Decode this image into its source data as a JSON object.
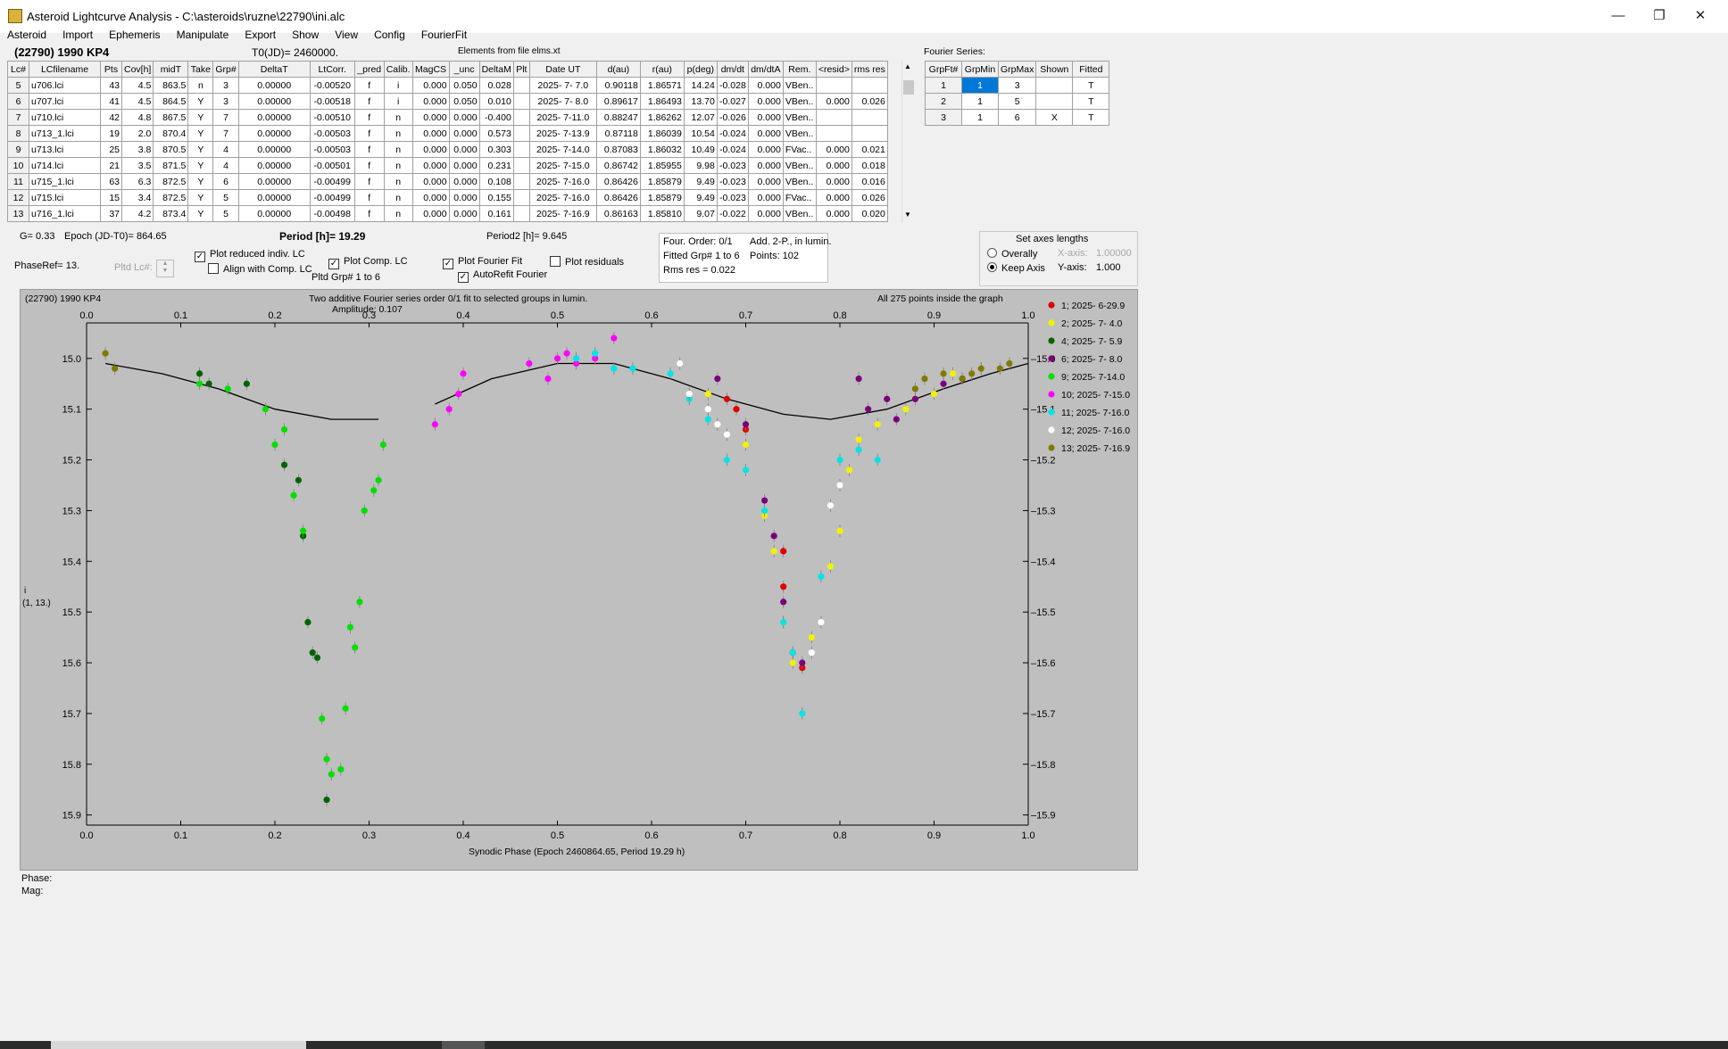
{
  "window": {
    "title": "Asteroid Lightcurve Analysis - C:\\asteroids\\ruzne\\22790\\ini.alc"
  },
  "menu": [
    "Asteroid",
    "Import",
    "Ephemeris",
    "Manipulate",
    "Export",
    "Show",
    "View",
    "Config",
    "FourierFit"
  ],
  "header": {
    "asteroid": "(22790) 1990 KP4",
    "t0": "T0(JD)= 2460000.",
    "elements": "Elements from file elms.xt",
    "fourier_series_label": "Fourier Series:"
  },
  "lc_table": {
    "columns": [
      "Lc#",
      "LCfilename",
      "Pts",
      "Cov[h]",
      "midT",
      "Take",
      "Grp#",
      "DeltaT",
      "LtCorr.",
      "_pred",
      "Calib.",
      "MagCS",
      "_unc",
      "DeltaM",
      "Plt",
      "Date UT",
      "d(au)",
      "r(au)",
      "p(deg)",
      "dm/dt",
      "dm/dtA",
      "Rem.",
      "<resid>",
      "rms res"
    ],
    "rows": [
      [
        "5",
        "u706.lci",
        "43",
        "4.5",
        "863.5",
        "n",
        "3",
        "0.00000",
        "-0.00520",
        "f",
        "i",
        "0.000",
        "0.050",
        "0.028",
        "",
        "2025- 7- 7.0",
        "0.90118",
        "1.86571",
        "14.24",
        "-0.028",
        "0.000",
        "VBen..",
        "",
        ""
      ],
      [
        "6",
        "u707.lci",
        "41",
        "4.5",
        "864.5",
        "Y",
        "3",
        "0.00000",
        "-0.00518",
        "f",
        "i",
        "0.000",
        "0.050",
        "0.010",
        "",
        "2025- 7- 8.0",
        "0.89617",
        "1.86493",
        "13.70",
        "-0.027",
        "0.000",
        "VBen..",
        "0.000",
        "0.026"
      ],
      [
        "7",
        "u710.lci",
        "42",
        "4.8",
        "867.5",
        "Y",
        "7",
        "0.00000",
        "-0.00510",
        "f",
        "n",
        "0.000",
        "0.000",
        "-0.400",
        "",
        "2025- 7-11.0",
        "0.88247",
        "1.86262",
        "12.07",
        "-0.026",
        "0.000",
        "VBen..",
        "",
        ""
      ],
      [
        "8",
        "u713_1.lci",
        "19",
        "2.0",
        "870.4",
        "Y",
        "7",
        "0.00000",
        "-0.00503",
        "f",
        "n",
        "0.000",
        "0.000",
        "0.573",
        "",
        "2025- 7-13.9",
        "0.87118",
        "1.86039",
        "10.54",
        "-0.024",
        "0.000",
        "VBen..",
        "",
        ""
      ],
      [
        "9",
        "u713.lci",
        "25",
        "3.8",
        "870.5",
        "Y",
        "4",
        "0.00000",
        "-0.00503",
        "f",
        "n",
        "0.000",
        "0.000",
        "0.303",
        "",
        "2025- 7-14.0",
        "0.87083",
        "1.86032",
        "10.49",
        "-0.024",
        "0.000",
        "FVac..",
        "0.000",
        "0.021"
      ],
      [
        "10",
        "u714.lci",
        "21",
        "3.5",
        "871.5",
        "Y",
        "4",
        "0.00000",
        "-0.00501",
        "f",
        "n",
        "0.000",
        "0.000",
        "0.231",
        "",
        "2025- 7-15.0",
        "0.86742",
        "1.85955",
        "9.98",
        "-0.023",
        "0.000",
        "VBen..",
        "0.000",
        "0.018"
      ],
      [
        "11",
        "u715_1.lci",
        "63",
        "6.3",
        "872.5",
        "Y",
        "6",
        "0.00000",
        "-0.00499",
        "f",
        "n",
        "0.000",
        "0.000",
        "0.108",
        "",
        "2025- 7-16.0",
        "0.86426",
        "1.85879",
        "9.49",
        "-0.023",
        "0.000",
        "VBen..",
        "0.000",
        "0.016"
      ],
      [
        "12",
        "u715.lci",
        "15",
        "3.4",
        "872.5",
        "Y",
        "5",
        "0.00000",
        "-0.00499",
        "f",
        "n",
        "0.000",
        "0.000",
        "0.155",
        "",
        "2025- 7-16.0",
        "0.86426",
        "1.85879",
        "9.49",
        "-0.023",
        "0.000",
        "FVac..",
        "0.000",
        "0.026"
      ],
      [
        "13",
        "u716_1.lci",
        "37",
        "4.2",
        "873.4",
        "Y",
        "5",
        "0.00000",
        "-0.00498",
        "f",
        "n",
        "0.000",
        "0.000",
        "0.161",
        "",
        "2025- 7-16.9",
        "0.86163",
        "1.85810",
        "9.07",
        "-0.022",
        "0.000",
        "VBen..",
        "0.000",
        "0.020"
      ]
    ]
  },
  "fourier_table": {
    "columns": [
      "GrpFt#",
      "GrpMin",
      "GrpMax",
      "Shown",
      "Fitted"
    ],
    "rows": [
      [
        "1",
        "1",
        "3",
        "",
        "T"
      ],
      [
        "2",
        "1",
        "5",
        "",
        "T"
      ],
      [
        "3",
        "1",
        "6",
        "X",
        "T"
      ]
    ]
  },
  "params": {
    "g": "G= 0.33",
    "epoch": "Epoch (JD-T0)= 864.65",
    "period": "Period [h]= 19.29",
    "period2": "Period2 [h]= 9.645",
    "phaseref": "PhaseRef= 13.",
    "pltd_lc": "Pltd Lc#:",
    "pltd_grp": "Pltd Grp#  1   to   6"
  },
  "options": {
    "plot_reduced": "Plot reduced indiv. LC",
    "align_comp": "Align with Comp. LC",
    "plot_comp": "Plot Comp. LC",
    "plot_fourier": "Plot Fourier Fit",
    "autorefit": "AutoRefit Fourier",
    "plot_residuals": "Plot residuals",
    "checked": {
      "plot_reduced": true,
      "align_comp": false,
      "plot_comp": true,
      "plot_fourier": true,
      "autorefit": true,
      "plot_residuals": false
    }
  },
  "fit_info": {
    "order": "Four. Order:  0/1",
    "add": "Add. 2-P., in lumin.",
    "fitted": "Fitted Grp# 1 to 6",
    "points": "Points: 102",
    "rms": "Rms res     = 0.022"
  },
  "axes_box": {
    "title": "Set axes lengths",
    "overally": "Overally",
    "keep": "Keep Axis",
    "xaxis_label": "X-axis:",
    "xaxis_value": "1.00000",
    "yaxis_label": "Y-axis:",
    "yaxis_value": "1.000",
    "selected": "keep"
  },
  "plot": {
    "corner": "(22790) 1990 KP4",
    "title": "Two additive Fourier series order 0/1 fit to selected groups in lumin.",
    "amplitude": "Amplitude: 0.107",
    "inside": "All 275 points inside the graph",
    "ylabel1": "i",
    "ylabel2": "(1, 13.)",
    "xlabel": "Synodic Phase (Epoch 2460864.65, Period 19.29 h)"
  },
  "readout": {
    "phase": "Phase:",
    "mag": "Mag:"
  },
  "chart_data": {
    "type": "scatter",
    "xlabel": "Synodic Phase (Epoch 2460864.65, Period 19.29 h)",
    "ylabel": "i",
    "xlim": [
      0.0,
      1.0
    ],
    "ylim": [
      15.92,
      14.93
    ],
    "xticks": [
      "0.0",
      "0.1",
      "0.2",
      "0.3",
      "0.4",
      "0.5",
      "0.6",
      "0.7",
      "0.8",
      "0.9",
      "1.0"
    ],
    "yticks": [
      "15.0",
      "15.1",
      "15.2",
      "15.3",
      "15.4",
      "15.5",
      "15.6",
      "15.7",
      "15.8",
      "15.9"
    ],
    "fourier_curve": [
      [
        0.02,
        15.01
      ],
      [
        0.08,
        15.03
      ],
      [
        0.14,
        15.06
      ],
      [
        0.2,
        15.1
      ],
      [
        0.26,
        15.12
      ],
      [
        0.31,
        15.12
      ],
      [
        0.37,
        15.09
      ],
      [
        0.43,
        15.04
      ],
      [
        0.5,
        15.01
      ],
      [
        0.56,
        15.01
      ],
      [
        0.62,
        15.04
      ],
      [
        0.68,
        15.08
      ],
      [
        0.74,
        15.11
      ],
      [
        0.79,
        15.12
      ],
      [
        0.85,
        15.1
      ],
      [
        0.91,
        15.06
      ],
      [
        0.96,
        15.03
      ],
      [
        1.0,
        15.01
      ]
    ],
    "fourier_gaps": [
      [
        0.315,
        0.37
      ]
    ],
    "series": [
      {
        "name": "1; 2025- 6-29.9",
        "color": "#e00000",
        "points": [
          [
            0.68,
            15.08
          ],
          [
            0.69,
            15.1
          ],
          [
            0.7,
            15.14
          ],
          [
            0.74,
            15.38
          ],
          [
            0.74,
            15.45
          ],
          [
            0.75,
            15.58
          ],
          [
            0.76,
            15.61
          ]
        ]
      },
      {
        "name": "2; 2025- 7- 4.0",
        "color": "#f2f200",
        "points": [
          [
            0.66,
            15.07
          ],
          [
            0.67,
            15.13
          ],
          [
            0.7,
            15.17
          ],
          [
            0.72,
            15.31
          ],
          [
            0.73,
            15.38
          ],
          [
            0.74,
            15.52
          ],
          [
            0.75,
            15.6
          ],
          [
            0.77,
            15.55
          ],
          [
            0.79,
            15.41
          ],
          [
            0.8,
            15.34
          ],
          [
            0.81,
            15.22
          ],
          [
            0.82,
            15.16
          ],
          [
            0.84,
            15.13
          ],
          [
            0.87,
            15.1
          ],
          [
            0.9,
            15.07
          ],
          [
            0.92,
            15.03
          ],
          [
            0.95,
            15.02
          ]
        ]
      },
      {
        "name": "4; 2025- 7- 5.9",
        "color": "#006400",
        "points": [
          [
            0.12,
            15.03
          ],
          [
            0.13,
            15.05
          ],
          [
            0.17,
            15.05
          ],
          [
            0.21,
            15.21
          ],
          [
            0.225,
            15.24
          ],
          [
            0.23,
            15.35
          ],
          [
            0.235,
            15.52
          ],
          [
            0.24,
            15.58
          ],
          [
            0.245,
            15.59
          ],
          [
            0.255,
            15.87
          ]
        ]
      },
      {
        "name": "6; 2025- 7- 8.0",
        "color": "#7a007a",
        "points": [
          [
            0.67,
            15.04
          ],
          [
            0.7,
            15.13
          ],
          [
            0.72,
            15.28
          ],
          [
            0.73,
            15.35
          ],
          [
            0.74,
            15.48
          ],
          [
            0.76,
            15.6
          ],
          [
            0.82,
            15.04
          ],
          [
            0.83,
            15.1
          ],
          [
            0.85,
            15.08
          ],
          [
            0.86,
            15.12
          ],
          [
            0.88,
            15.08
          ],
          [
            0.91,
            15.05
          ],
          [
            0.93,
            15.04
          ]
        ]
      },
      {
        "name": "9; 2025- 7-14.0",
        "color": "#00e000",
        "points": [
          [
            0.12,
            15.05
          ],
          [
            0.15,
            15.06
          ],
          [
            0.19,
            15.1
          ],
          [
            0.2,
            15.17
          ],
          [
            0.21,
            15.14
          ],
          [
            0.22,
            15.27
          ],
          [
            0.23,
            15.34
          ],
          [
            0.25,
            15.71
          ],
          [
            0.255,
            15.79
          ],
          [
            0.26,
            15.82
          ],
          [
            0.27,
            15.81
          ],
          [
            0.275,
            15.69
          ],
          [
            0.28,
            15.53
          ],
          [
            0.285,
            15.57
          ],
          [
            0.29,
            15.48
          ],
          [
            0.295,
            15.3
          ],
          [
            0.305,
            15.26
          ],
          [
            0.31,
            15.24
          ],
          [
            0.315,
            15.17
          ]
        ]
      },
      {
        "name": "10; 2025- 7-15.0",
        "color": "#ff00ff",
        "points": [
          [
            0.37,
            15.13
          ],
          [
            0.385,
            15.1
          ],
          [
            0.395,
            15.07
          ],
          [
            0.4,
            15.03
          ],
          [
            0.47,
            15.01
          ],
          [
            0.49,
            15.04
          ],
          [
            0.5,
            15.0
          ],
          [
            0.51,
            14.99
          ],
          [
            0.52,
            15.01
          ],
          [
            0.54,
            15.0
          ],
          [
            0.56,
            14.96
          ]
        ]
      },
      {
        "name": "11; 2025- 7-16.0",
        "color": "#00e5e5",
        "points": [
          [
            0.52,
            15.0
          ],
          [
            0.54,
            14.99
          ],
          [
            0.56,
            15.02
          ],
          [
            0.58,
            15.02
          ],
          [
            0.62,
            15.03
          ],
          [
            0.64,
            15.08
          ],
          [
            0.66,
            15.12
          ],
          [
            0.68,
            15.2
          ],
          [
            0.7,
            15.22
          ],
          [
            0.72,
            15.3
          ],
          [
            0.74,
            15.52
          ],
          [
            0.75,
            15.58
          ],
          [
            0.76,
            15.7
          ],
          [
            0.78,
            15.43
          ],
          [
            0.8,
            15.2
          ],
          [
            0.82,
            15.18
          ],
          [
            0.84,
            15.2
          ]
        ]
      },
      {
        "name": "12; 2025- 7-16.0",
        "color": "#ffffff",
        "points": [
          [
            0.63,
            15.01
          ],
          [
            0.64,
            15.07
          ],
          [
            0.66,
            15.1
          ],
          [
            0.67,
            15.13
          ],
          [
            0.68,
            15.15
          ],
          [
            0.77,
            15.58
          ],
          [
            0.78,
            15.52
          ],
          [
            0.79,
            15.29
          ],
          [
            0.8,
            15.25
          ]
        ]
      },
      {
        "name": "13; 2025- 7-16.9",
        "color": "#7f7a00",
        "points": [
          [
            0.02,
            14.99
          ],
          [
            0.03,
            15.02
          ],
          [
            0.88,
            15.06
          ],
          [
            0.89,
            15.04
          ],
          [
            0.91,
            15.03
          ],
          [
            0.93,
            15.04
          ],
          [
            0.94,
            15.03
          ],
          [
            0.95,
            15.02
          ],
          [
            0.97,
            15.02
          ],
          [
            0.98,
            15.01
          ]
        ]
      }
    ]
  }
}
